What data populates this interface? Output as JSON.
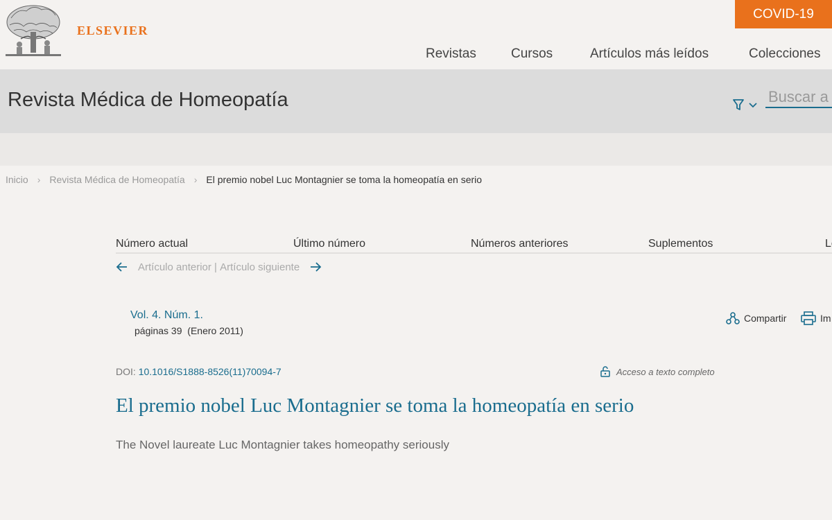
{
  "header": {
    "brand": "ELSEVIER",
    "covid_label": "COVID-19",
    "nav": [
      "Revistas",
      "Cursos",
      "Artículos más leídos",
      "Colecciones"
    ]
  },
  "journal": {
    "title": "Revista Médica de Homeopatía",
    "search_placeholder": "Buscar a"
  },
  "breadcrumb": [
    "Inicio",
    "Revista Médica de Homeopatía",
    "El premio nobel Luc Montagnier se toma la homeopatía en serio"
  ],
  "journal_nav": [
    "Número actual",
    "Último número",
    "Números anteriores",
    "Suplementos",
    "Le"
  ],
  "prev_next": {
    "prev": "Artículo anterior",
    "separator": " | ",
    "next": "Artículo siguiente"
  },
  "issue": {
    "volume": "Vol. 4. Núm. 1.",
    "pages": "páginas 39  (Enero 2011)"
  },
  "actions": {
    "share": "Compartir",
    "print": "Im"
  },
  "doi": {
    "label": "DOI: ",
    "value": "10.1016/S1888-8526(11)70094-7"
  },
  "access_label": "Acceso a texto completo",
  "article": {
    "title": "El premio nobel Luc Montagnier se toma la homeopatía en serio",
    "subtitle": "The Novel laureate Luc Montagnier takes homeopathy seriously"
  },
  "colors": {
    "brand_orange": "#e9711c",
    "link_blue": "#1a6d8e"
  }
}
